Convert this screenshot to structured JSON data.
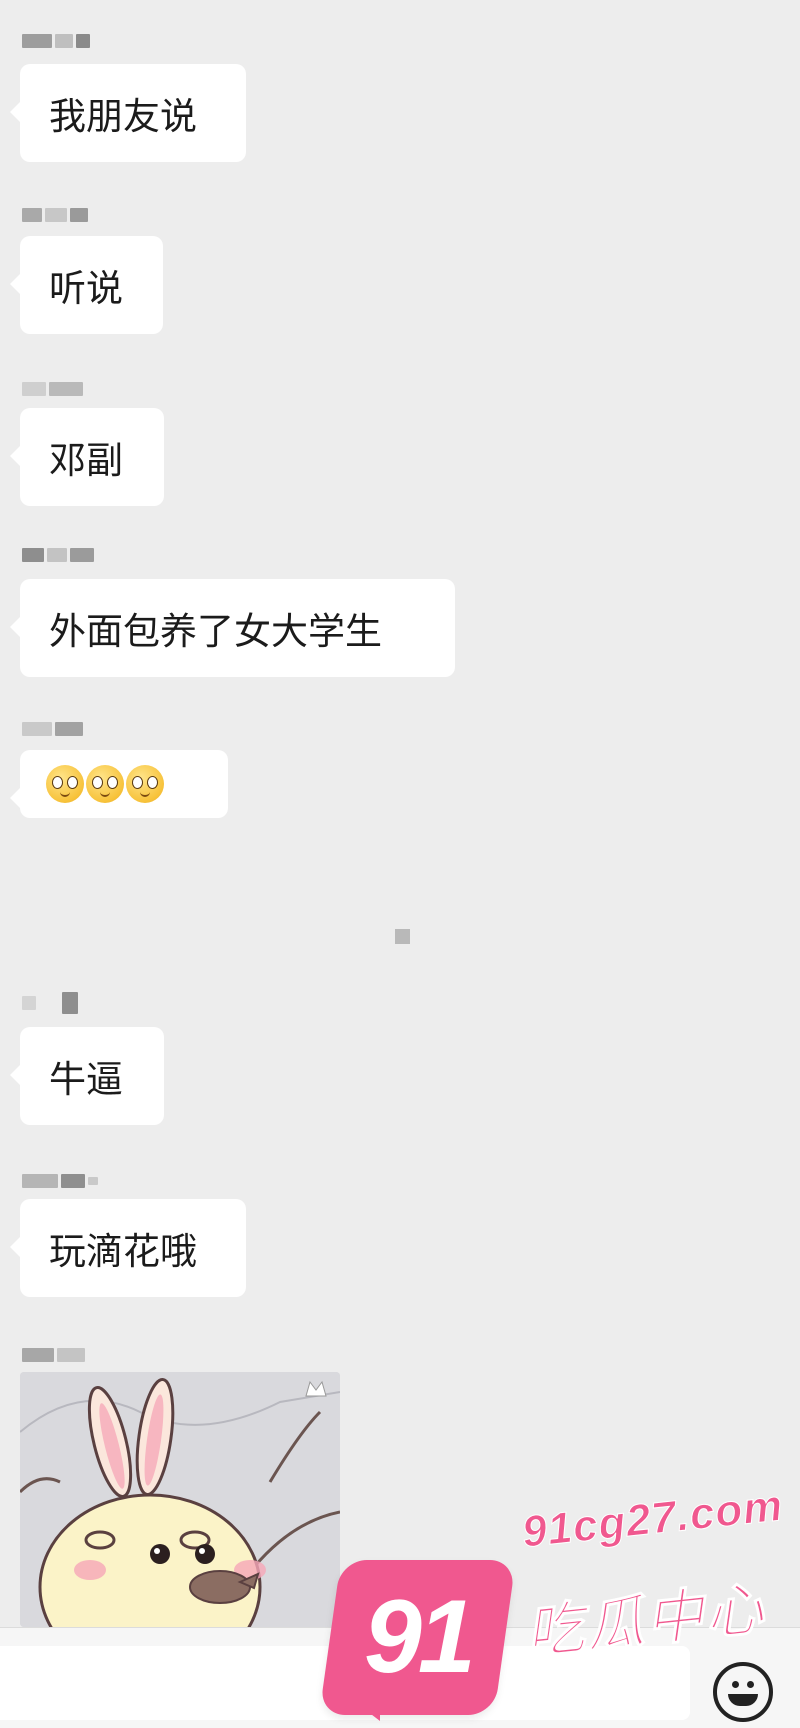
{
  "messages": [
    {
      "text": "我朋友说"
    },
    {
      "text": "听说"
    },
    {
      "text": "邓副"
    },
    {
      "text": "外面包养了女大学生"
    },
    {
      "emojis": [
        "smile-sweat-emoji",
        "smile-sweat-emoji",
        "smile-sweat-emoji"
      ]
    },
    {
      "text": "牛逼"
    },
    {
      "text": "玩滴花哦"
    },
    {
      "sticker": "rabbit-eating-sticker"
    }
  ],
  "input_bar": {
    "value": "",
    "emoji_button_icon": "smiley-icon"
  },
  "watermark": {
    "badge": "91",
    "domain": "91cg27.com",
    "name": "吃瓜中心",
    "color": "#f0588f"
  },
  "colors": {
    "background": "#ededed",
    "bubble": "#ffffff"
  }
}
